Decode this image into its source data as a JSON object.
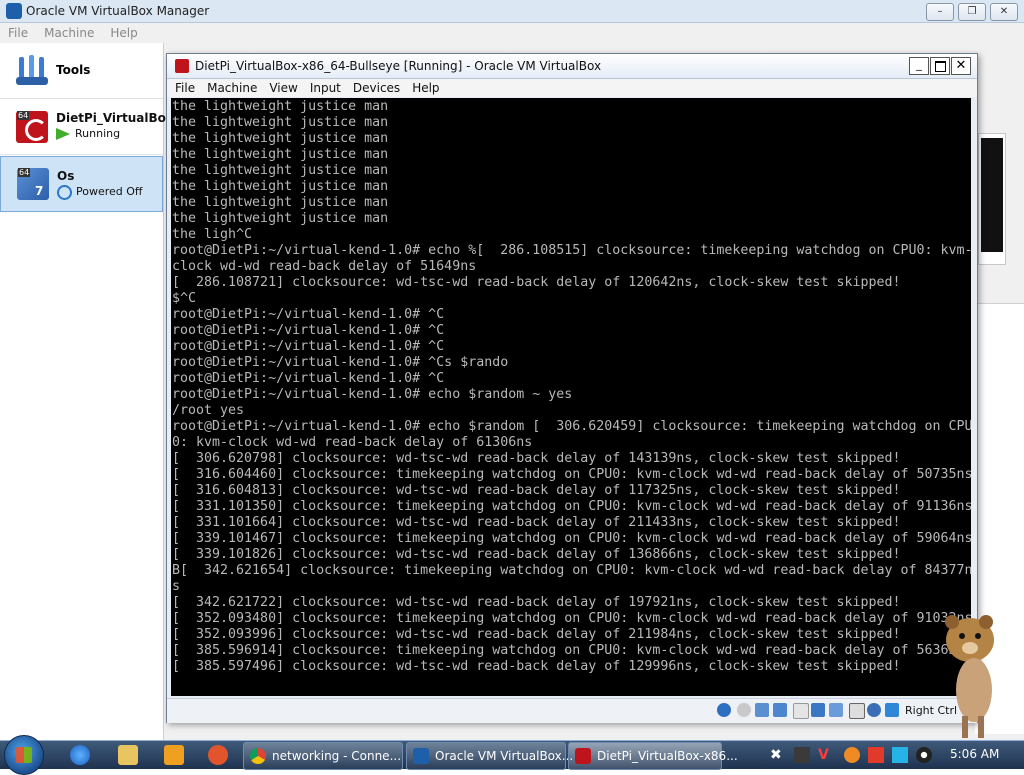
{
  "manager": {
    "title": "Oracle VM VirtualBox Manager",
    "menu": [
      "File",
      "Machine",
      "Help"
    ],
    "tools_label": "Tools",
    "vms": [
      {
        "name": "DietPi_VirtualBox-x",
        "state": "Running",
        "badge": "64"
      },
      {
        "name": "Os",
        "state": "Powered Off",
        "badge": "64",
        "badge2": "7"
      }
    ]
  },
  "vm_window": {
    "title": "DietPi_VirtualBox-x86_64-Bullseye [Running] - Oracle VM VirtualBox",
    "menu": [
      "File",
      "Machine",
      "View",
      "Input",
      "Devices",
      "Help"
    ],
    "host_key": "Right Ctrl"
  },
  "terminal": {
    "lines": [
      "the lightweight justice man",
      "the lightweight justice man",
      "the lightweight justice man",
      "the lightweight justice man",
      "the lightweight justice man",
      "the lightweight justice man",
      "the lightweight justice man",
      "the lightweight justice man",
      "the ligh^C",
      "root@DietPi:~/virtual-kend-1.0# echo %[  286.108515] clocksource: timekeeping watchdog on CPU0: kvm-",
      "clock wd-wd read-back delay of 51649ns",
      "[  286.108721] clocksource: wd-tsc-wd read-back delay of 120642ns, clock-skew test skipped!",
      "$^C",
      "root@DietPi:~/virtual-kend-1.0# ^C",
      "root@DietPi:~/virtual-kend-1.0# ^C",
      "root@DietPi:~/virtual-kend-1.0# ^C",
      "root@DietPi:~/virtual-kend-1.0# ^Cs $rando",
      "root@DietPi:~/virtual-kend-1.0# ^C",
      "root@DietPi:~/virtual-kend-1.0# echo $random ~ yes",
      "/root yes",
      "root@DietPi:~/virtual-kend-1.0# echo $random [  306.620459] clocksource: timekeeping watchdog on CPU",
      "0: kvm-clock wd-wd read-back delay of 61306ns",
      "[  306.620798] clocksource: wd-tsc-wd read-back delay of 143139ns, clock-skew test skipped!",
      "[  316.604460] clocksource: timekeeping watchdog on CPU0: kvm-clock wd-wd read-back delay of 50735ns",
      "[  316.604813] clocksource: wd-tsc-wd read-back delay of 117325ns, clock-skew test skipped!",
      "[  331.101350] clocksource: timekeeping watchdog on CPU0: kvm-clock wd-wd read-back delay of 91136ns",
      "[  331.101664] clocksource: wd-tsc-wd read-back delay of 211433ns, clock-skew test skipped!",
      "[  339.101467] clocksource: timekeeping watchdog on CPU0: kvm-clock wd-wd read-back delay of 59064ns",
      "[  339.101826] clocksource: wd-tsc-wd read-back delay of 136866ns, clock-skew test skipped!",
      "B[  342.621654] clocksource: timekeeping watchdog on CPU0: kvm-clock wd-wd read-back delay of 84377n",
      "s",
      "[  342.621722] clocksource: wd-tsc-wd read-back delay of 197921ns, clock-skew test skipped!",
      "[  352.093480] clocksource: timekeeping watchdog on CPU0: kvm-clock wd-wd read-back delay of 91032ns",
      "[  352.093996] clocksource: wd-tsc-wd read-back delay of 211984ns, clock-skew test skipped!",
      "[  385.596914] clocksource: timekeeping watchdog on CPU0: kvm-clock wd-wd read-back delay of 56363ns",
      "[  385.597496] clocksource: wd-tsc-wd read-back delay of 129996ns, clock-skew test skipped!"
    ]
  },
  "taskbar": {
    "buttons": [
      {
        "label": "networking - Conne...",
        "icon": "chrome-icon"
      },
      {
        "label": "Oracle VM VirtualBox...",
        "icon": "virtualbox-icon"
      },
      {
        "label": "DietPi_VirtualBox-x86...",
        "icon": "debian-icon"
      }
    ],
    "clock": "5:06 AM"
  },
  "colors": {
    "terminal_bg": "#000000",
    "terminal_fg": "#b8b8b8",
    "taskbar": "#1f3350",
    "selection": "#cfe3f7"
  }
}
